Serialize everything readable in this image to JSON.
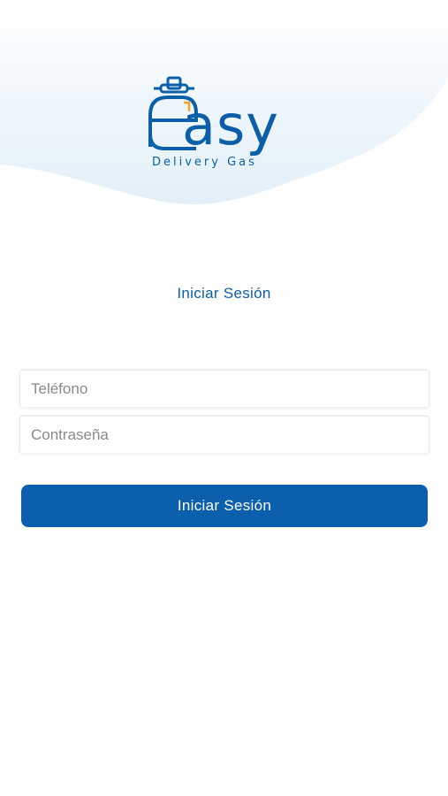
{
  "brand": {
    "wordmark": "asy",
    "tagline": "Delivery Gas",
    "primary_color": "#0b5ea8",
    "accent_color": "#f5a623",
    "logo_icon": "gas-cylinder-icon"
  },
  "login": {
    "title": "Iniciar Sesión",
    "phone_placeholder": "Teléfono",
    "password_placeholder": "Contraseña",
    "submit_label": "Iniciar Sesión",
    "button_color": "#0b5fad"
  }
}
